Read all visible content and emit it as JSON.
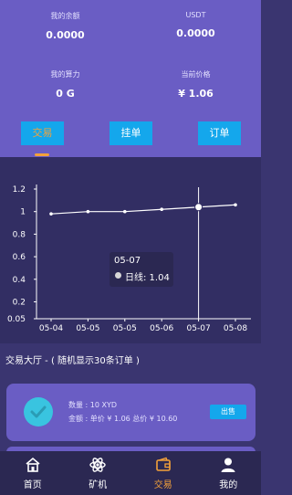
{
  "stats": {
    "balance": {
      "label": "我的余额",
      "value": "0.0000"
    },
    "usdt": {
      "label": "USDT",
      "value": "0.0000"
    },
    "power": {
      "label": "我的算力",
      "value": "0 G"
    },
    "price": {
      "label": "当前价格",
      "value": "¥ 1.06"
    }
  },
  "tabs": {
    "trade": "交易",
    "pending": "挂单",
    "orders": "订单"
  },
  "tooltip": {
    "date": "05-07",
    "label": "日线: 1.04"
  },
  "chart_data": {
    "type": "line",
    "categories": [
      "05-04",
      "05-05",
      "05-05",
      "05-06",
      "05-07",
      "05-08"
    ],
    "values": [
      0.98,
      1.0,
      1.0,
      1.02,
      1.04,
      1.06
    ],
    "yticks": [
      "1.2",
      "1",
      "0.8",
      "0.6",
      "0.4",
      "0.2",
      "0.05"
    ],
    "ylim": [
      0.05,
      1.2
    ],
    "highlight_index": 4
  },
  "hall": {
    "title": "交易大厅 - ( 随机显示30条订单 )"
  },
  "order": {
    "qty": "数量 : 10 XYD",
    "amount": "金额 : 单价 ¥ 1.06 总价 ¥ 10.60",
    "sell": "出售"
  },
  "nav": {
    "home": "首页",
    "miner": "矿机",
    "trade": "交易",
    "mine": "我的"
  },
  "colors": {
    "panel": "#6a5dc4",
    "accent": "#14a7ec",
    "active": "#f3a13a"
  }
}
